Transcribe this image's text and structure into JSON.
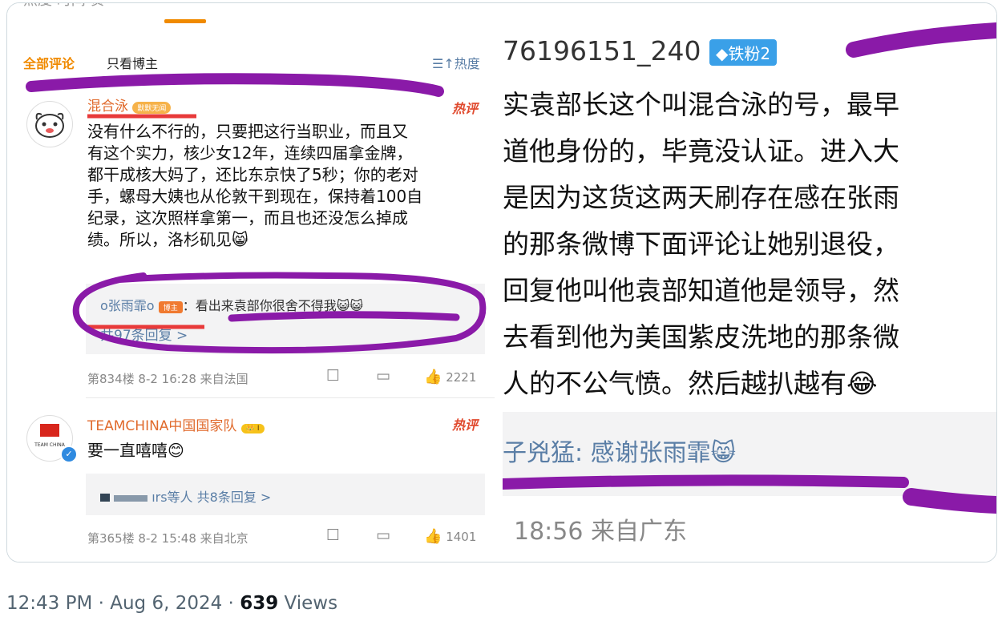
{
  "left": {
    "tabs_clipped": "热度  时间  赞",
    "tab_all": "全部评论",
    "tab_owner": "只看博主",
    "sort_label": "热度",
    "comment1": {
      "username": "混合泳",
      "badge": "默默无闻",
      "hot": "热评",
      "lines": [
        "没有什么不行的，只要把这行当职业，而且又",
        "有这个实力，核少女12年，连续四届拿金牌，",
        "都干成核大妈了，还比东京快了5秒；你的老对",
        "手，螺母大姨也从伦敦干到现在，保持着100自",
        "纪录，这次照样拿第一，而且也还没怎么掉成",
        "绩。所以，洛杉矶见😸"
      ],
      "reply_name": "o张雨霏o",
      "reply_badge": "博主",
      "reply_text": "：看出来袁部你很舍不得我😺😺",
      "reply_count": "共97条回复 >",
      "floor": "第834楼 8-2 16:28 来自法国",
      "likes": "2221"
    },
    "comment2": {
      "username": "TEAMCHINA中国国家队",
      "level": "I",
      "hot": "热评",
      "text": "要一直嘻嘻😊",
      "reply_users": "ırs等人",
      "reply_count": "共8条回复 >",
      "floor": "第365楼 8-2 15:48 来自北京",
      "likes": "1401",
      "avatar_text": "TEAM CHINA"
    }
  },
  "right": {
    "user": "76196151_240",
    "fan_badge": "◆铁粉2",
    "lines": [
      "实袁部长这个叫混合泳的号，最早",
      "道他身份的，毕竟没认证。进入大",
      "是因为这货这两天刷存在感在张雨",
      "的那条微博下面评论让她别退役，",
      "回复他叫他袁部知道他是领导，然",
      "去看到他为美国紫皮洗地的那条微",
      "人的不公气愤。然后越扒越有😂"
    ],
    "reply": "子兇猛: 感谢张雨霏😸",
    "time": "18:56 来自广东"
  },
  "footer": {
    "time": "12:43 PM · Aug 6, 2024 · ",
    "views_count": "639",
    "views_label": " Views"
  },
  "colors": {
    "accent_orange": "#f08a00",
    "link_blue": "#5a7ea6",
    "marker_purple": "#8a1aa8",
    "marker_red": "#e83a3a"
  }
}
